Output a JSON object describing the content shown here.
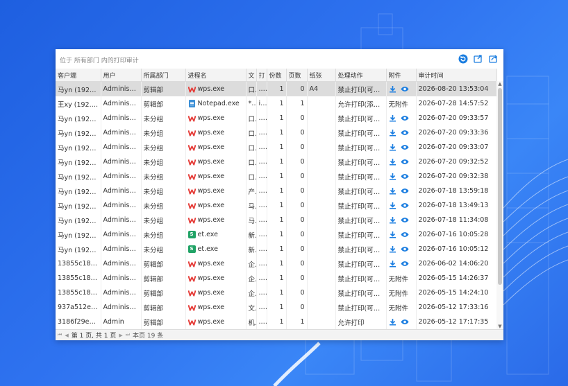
{
  "toolbar": {
    "title": "位于 所有部门 内的打印审计"
  },
  "colors": {
    "accent": "#1a7de0",
    "wps_red": "#e53935",
    "et_green": "#21a366"
  },
  "icons": [
    "refresh-icon",
    "export-icon",
    "share-icon",
    "download-icon",
    "eye-icon",
    "wps-icon",
    "notepad-icon",
    "et-icon"
  ],
  "columns": [
    "客户端",
    "用户",
    "所属部门",
    "进程名",
    "文",
    "打",
    "份数",
    "页数",
    "纸张",
    "处理动作",
    "附件",
    "审计时间"
  ],
  "rows": [
    {
      "client": "马yn (192.16...",
      "user": "Administra...",
      "dept": "剪辑部",
      "proc": "wps.exe",
      "proc_icon": "wps",
      "doc": "口",
      "pr": "...",
      "copies": "1",
      "pages": "0",
      "paper": "A4",
      "action": "禁止打印(可申请)",
      "att": "icons",
      "time": "2026-08-20 13:53:04",
      "selected": true
    },
    {
      "client": "王xy (192.16...",
      "user": "Administra...",
      "dept": "剪辑部",
      "proc": "Notepad.exe",
      "proc_icon": "notepad",
      "doc": "*...",
      "pr": "i...",
      "copies": "1",
      "pages": "1",
      "paper": "",
      "action": "允许打印(添加...",
      "att": "无附件",
      "time": "2026-07-28 14:57:52"
    },
    {
      "client": "马yn (192.16...",
      "user": "Administra...",
      "dept": "未分组",
      "proc": "wps.exe",
      "proc_icon": "wps",
      "doc": "口",
      "pr": "...",
      "copies": "1",
      "pages": "0",
      "paper": "",
      "action": "禁止打印(可申请)",
      "att": "icons",
      "time": "2026-07-20 09:33:57"
    },
    {
      "client": "马yn (192.16...",
      "user": "Administra...",
      "dept": "未分组",
      "proc": "wps.exe",
      "proc_icon": "wps",
      "doc": "口",
      "pr": "...",
      "copies": "1",
      "pages": "0",
      "paper": "",
      "action": "禁止打印(可申请)",
      "att": "icons",
      "time": "2026-07-20 09:33:36"
    },
    {
      "client": "马yn (192.16...",
      "user": "Administra...",
      "dept": "未分组",
      "proc": "wps.exe",
      "proc_icon": "wps",
      "doc": "口",
      "pr": "...",
      "copies": "1",
      "pages": "0",
      "paper": "",
      "action": "禁止打印(可申请)",
      "att": "icons",
      "time": "2026-07-20 09:33:07"
    },
    {
      "client": "马yn (192.16...",
      "user": "Administra...",
      "dept": "未分组",
      "proc": "wps.exe",
      "proc_icon": "wps",
      "doc": "口",
      "pr": "...",
      "copies": "1",
      "pages": "0",
      "paper": "",
      "action": "禁止打印(可申请)",
      "att": "icons",
      "time": "2026-07-20 09:32:52"
    },
    {
      "client": "马yn (192.16...",
      "user": "Administra...",
      "dept": "未分组",
      "proc": "wps.exe",
      "proc_icon": "wps",
      "doc": "口",
      "pr": "...",
      "copies": "1",
      "pages": "0",
      "paper": "",
      "action": "禁止打印(可申请)",
      "att": "icons",
      "time": "2026-07-20 09:32:38"
    },
    {
      "client": "马yn (192.16...",
      "user": "Administra...",
      "dept": "未分组",
      "proc": "wps.exe",
      "proc_icon": "wps",
      "doc": "产",
      "pr": "...",
      "copies": "1",
      "pages": "0",
      "paper": "",
      "action": "禁止打印(可申请)",
      "att": "icons",
      "time": "2026-07-18 13:59:18"
    },
    {
      "client": "马yn (192.16...",
      "user": "Administra...",
      "dept": "未分组",
      "proc": "wps.exe",
      "proc_icon": "wps",
      "doc": "马",
      "pr": "...",
      "copies": "1",
      "pages": "0",
      "paper": "",
      "action": "禁止打印(可申请)",
      "att": "icons",
      "time": "2026-07-18 13:49:13"
    },
    {
      "client": "马yn (192.16...",
      "user": "Administra...",
      "dept": "未分组",
      "proc": "wps.exe",
      "proc_icon": "wps",
      "doc": "马",
      "pr": "...",
      "copies": "1",
      "pages": "0",
      "paper": "",
      "action": "禁止打印(可申请)",
      "att": "icons",
      "time": "2026-07-18 11:34:08"
    },
    {
      "client": "马yn (192.16...",
      "user": "Administra...",
      "dept": "未分组",
      "proc": "et.exe",
      "proc_icon": "et",
      "doc": "新",
      "pr": "...",
      "copies": "1",
      "pages": "0",
      "paper": "",
      "action": "禁止打印(可申请)",
      "att": "icons",
      "time": "2026-07-16 10:05:28"
    },
    {
      "client": "马yn (192.16...",
      "user": "Administra...",
      "dept": "未分组",
      "proc": "et.exe",
      "proc_icon": "et",
      "doc": "新",
      "pr": "...",
      "copies": "1",
      "pages": "0",
      "paper": "",
      "action": "禁止打印(可申请)",
      "att": "icons",
      "time": "2026-07-16 10:05:12"
    },
    {
      "client": "13855c18b5...",
      "user": "Administra...",
      "dept": "剪辑部",
      "proc": "wps.exe",
      "proc_icon": "wps",
      "doc": "企",
      "pr": "...",
      "copies": "1",
      "pages": "0",
      "paper": "",
      "action": "禁止打印(可申请)",
      "att": "icons",
      "time": "2026-06-02 14:06:20"
    },
    {
      "client": "13855c18b5...",
      "user": "Administra...",
      "dept": "剪辑部",
      "proc": "wps.exe",
      "proc_icon": "wps",
      "doc": "企",
      "pr": "...",
      "copies": "1",
      "pages": "0",
      "paper": "",
      "action": "禁止打印(可申请)",
      "att": "无附件",
      "time": "2026-05-15 14:26:37"
    },
    {
      "client": "13855c18b5...",
      "user": "Administra...",
      "dept": "剪辑部",
      "proc": "wps.exe",
      "proc_icon": "wps",
      "doc": "企",
      "pr": "...",
      "copies": "1",
      "pages": "0",
      "paper": "",
      "action": "禁止打印(可申请)",
      "att": "无附件",
      "time": "2026-05-15 14:24:10"
    },
    {
      "client": "937a512e69...",
      "user": "Administra...",
      "dept": "剪辑部",
      "proc": "wps.exe",
      "proc_icon": "wps",
      "doc": "文",
      "pr": "...",
      "copies": "1",
      "pages": "0",
      "paper": "",
      "action": "禁止打印(可申请)",
      "att": "无附件",
      "time": "2026-05-12 17:33:16"
    },
    {
      "client": "3186f29ec4c...",
      "user": "Admin",
      "dept": "剪辑部",
      "proc": "wps.exe",
      "proc_icon": "wps",
      "doc": "机",
      "pr": "...",
      "copies": "1",
      "pages": "1",
      "paper": "",
      "action": "允许打印",
      "att": "icons",
      "time": "2026-05-12 17:17:35"
    }
  ],
  "footer": {
    "page_text": "第 1 页, 共 1 页",
    "count_text": "本页 19 条"
  }
}
